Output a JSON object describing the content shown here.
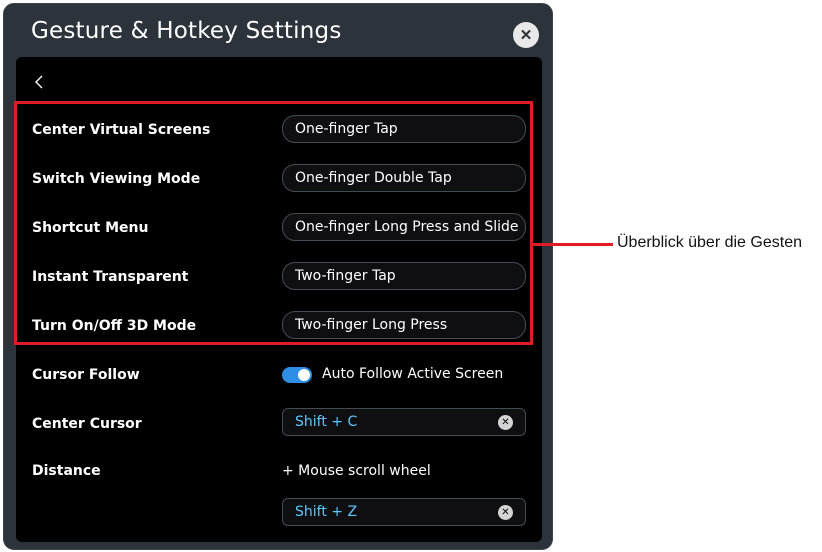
{
  "dialog": {
    "title": "Gesture & Hotkey Settings",
    "close_label": "✕"
  },
  "gestures": [
    {
      "label": "Center Virtual Screens",
      "value": "One-finger Tap"
    },
    {
      "label": "Switch Viewing Mode",
      "value": "One-finger Double Tap"
    },
    {
      "label": "Shortcut Menu",
      "value": "One-finger Long Press and Slide"
    },
    {
      "label": "Instant Transparent",
      "value": "Two-finger Tap"
    },
    {
      "label": "Turn On/Off 3D Mode",
      "value": "Two-finger Long Press"
    }
  ],
  "cursor_follow": {
    "label": "Cursor Follow",
    "toggle_label": "Auto Follow Active Screen",
    "enabled": true
  },
  "center_cursor": {
    "label": "Center Cursor",
    "hotkey": "Shift + C"
  },
  "distance": {
    "label": "Distance",
    "modifier_text": "+ Mouse scroll wheel",
    "hotkey": "Shift + Z"
  },
  "callout": {
    "text": "Überblick über die Gesten"
  },
  "colors": {
    "dialog_bg": "#2d333a",
    "panel_bg": "#000000",
    "highlight": "#e11c25",
    "hotkey_text": "#5cc8ff",
    "toggle_on": "#2d8ee3"
  }
}
